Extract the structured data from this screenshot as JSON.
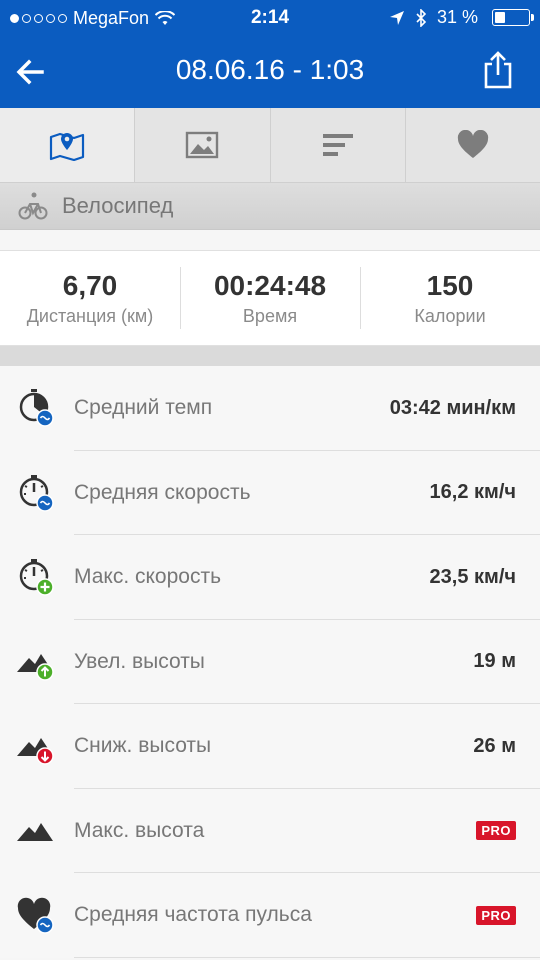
{
  "status": {
    "carrier": "MegaFon",
    "time": "2:14",
    "battery": "31 %",
    "battery_level": 0.31,
    "signal_bars_filled": 1,
    "signal_bars_total": 5
  },
  "nav": {
    "title": "08.06.16 - 1:03"
  },
  "tabs": [
    {
      "icon": "map-icon",
      "active": true
    },
    {
      "icon": "image-icon",
      "active": false
    },
    {
      "icon": "bar-list-icon",
      "active": false
    },
    {
      "icon": "heart-icon",
      "active": false
    }
  ],
  "activity": {
    "label": "Велосипед",
    "icon": "bicycle-icon"
  },
  "summary": [
    {
      "value": "6,70",
      "label": "Дистанция (км)"
    },
    {
      "value": "00:24:48",
      "label": "Время"
    },
    {
      "value": "150",
      "label": "Калории"
    }
  ],
  "stats": [
    {
      "label": "Средний темп",
      "value": "03:42 мин/км",
      "icon": "pace-clock-icon"
    },
    {
      "label": "Средняя скорость",
      "value": "16,2 км/ч",
      "icon": "speedometer-avg-icon"
    },
    {
      "label": "Макс. скорость",
      "value": "23,5 км/ч",
      "icon": "speedometer-max-icon"
    },
    {
      "label": "Увел. высоты",
      "value": "19 м",
      "icon": "elevation-gain-icon"
    },
    {
      "label": "Сниж. высоты",
      "value": "26 м",
      "icon": "elevation-loss-icon"
    },
    {
      "label": "Макс. высота",
      "value": "PRO",
      "icon": "mountain-icon"
    },
    {
      "label": "Средняя частота пульса",
      "value": "PRO",
      "icon": "heart-rate-icon"
    }
  ],
  "colors": {
    "brand_blue": "#0b5cc0",
    "pro_red": "#d8152a",
    "badge_blue": "#1565c0",
    "badge_green": "#4caf2a",
    "badge_red": "#d8152a"
  }
}
